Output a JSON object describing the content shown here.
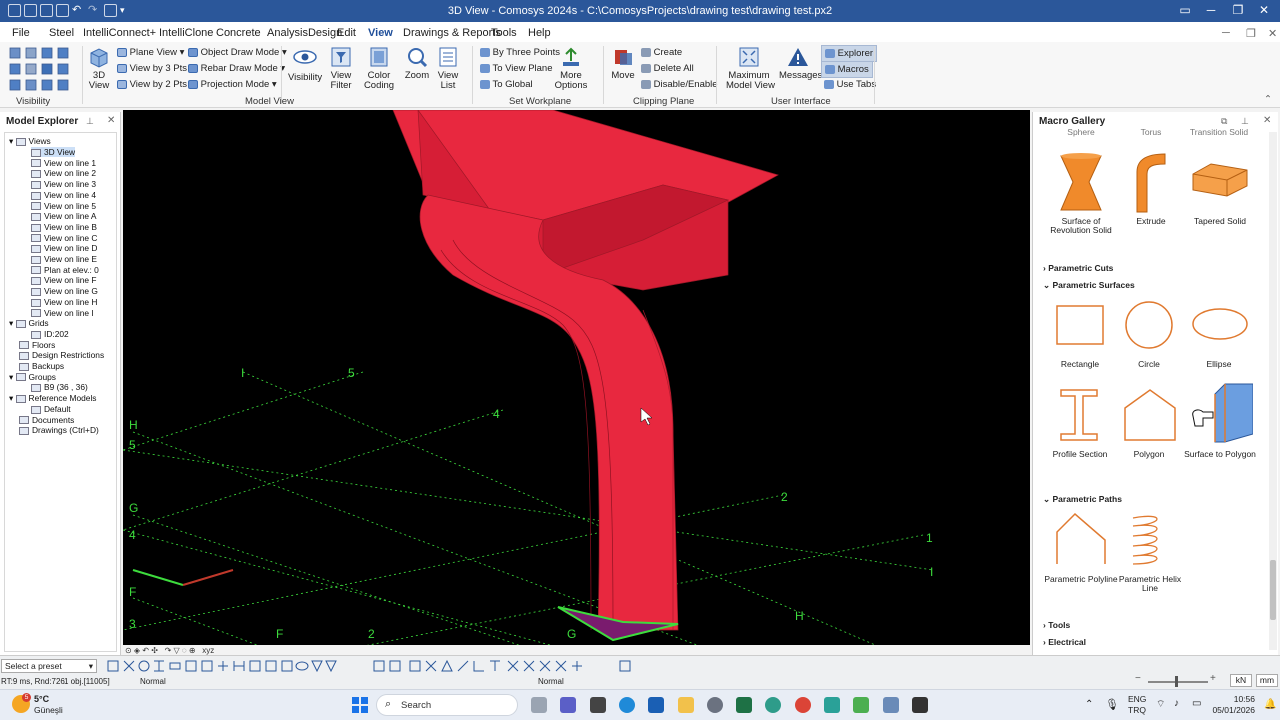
{
  "titlebar": {
    "title": "3D View - Comosys 2024s - C:\\ComosysProjects\\drawing test\\drawing test.px2"
  },
  "menu": [
    "File",
    "Steel",
    "IntelliConnect+",
    "IntelliClone",
    "Concrete",
    "AnalysisDesign",
    "Edit",
    "View",
    "Drawings & Reports",
    "Tools",
    "Help"
  ],
  "menu_active": "View",
  "ribbon": {
    "view3d": "3D\nView",
    "plane_view": "Plane View",
    "view_by_3pts": "View by 3 Pts",
    "view_by_2pts": "View by 2 Pts",
    "object_draw_mode": "Object Draw Mode",
    "rebar_draw_mode": "Rebar Draw Mode",
    "projection_mode": "Projection Mode",
    "visibility": "Visibility",
    "view_filter": "View\nFilter",
    "color_coding": "Color\nCoding",
    "zoom": "Zoom",
    "view_list": "View\nList",
    "by_three_points": "By Three Points",
    "to_view_plane": "To View Plane",
    "to_global": "To Global",
    "more_options": "More\nOptions",
    "move": "Move",
    "create": "Create",
    "delete_all": "Delete All",
    "disable_enable": "Disable/Enable",
    "maximum_model_view": "Maximum\nModel View",
    "messages": "Messages",
    "explorer": "Explorer",
    "macros": "Macros",
    "use_tabs": "Use Tabs",
    "groups": {
      "visibility": "Visibility",
      "model_view": "Model View",
      "set_workplane": "Set Workplane",
      "clipping_plane": "Clipping Plane",
      "user_interface": "User Interface"
    }
  },
  "model_explorer": {
    "title": "Model Explorer",
    "items": [
      "Views",
      "3D View",
      "View on line 1",
      "View on line 2",
      "View on line 3",
      "View on line 4",
      "View on line 5",
      "View on line A",
      "View on line B",
      "View on line C",
      "View on line D",
      "View on line E",
      "Plan at elev.: 0",
      "View on line F",
      "View on line G",
      "View on line H",
      "View on line I",
      "Grids",
      "ID:202",
      "Floors",
      "Design Restrictions",
      "Backups",
      "Groups",
      "B9 (36 , 36)",
      "Reference Models",
      "Default",
      "Documents",
      "Drawings (Ctrl+D)"
    ]
  },
  "viewport": {
    "grid_labels": [
      "I",
      "5",
      "4",
      "H",
      "5",
      "G",
      "4",
      "F",
      "3",
      "F",
      "2",
      "2",
      "1",
      "I",
      "H",
      "G"
    ],
    "body_color": "#e8283f",
    "grid_color": "#3ddc3d"
  },
  "macro_gallery": {
    "title": "Macro Gallery",
    "top_row": [
      "Sphere",
      "Torus",
      "Transition Solid"
    ],
    "solids": [
      "Surface of\nRevolution Solid",
      "Extrude",
      "Tapered Solid"
    ],
    "sections": {
      "cuts": "Parametric Cuts",
      "surfaces": "Parametric Surfaces",
      "paths": "Parametric Paths",
      "tools": "Tools",
      "electrical": "Electrical"
    },
    "surfaces": [
      "Rectangle",
      "Circle",
      "Ellipse",
      "Profile Section",
      "Polygon",
      "Surface to Polygon"
    ],
    "paths": [
      "Parametric Polyline",
      "Parametric Helix Line"
    ],
    "accent": "#e07a30"
  },
  "statusbar": {
    "preset": "Select a preset",
    "viewport_coords": "xyz",
    "rt": "RT:9 ms, Rnd:726",
    "selection": "1 obj.[11005]",
    "mode_left": "Normal",
    "mode_center": "Normal",
    "unit_force": "kN",
    "unit_length": "mm"
  },
  "taskbar": {
    "weather_temp": "5°C",
    "weather_desc": "Güneşli",
    "search": "Search",
    "lang": "ENG",
    "region": "TRQ",
    "time": "10:56",
    "date": "05/01/2026",
    "badge": "5"
  }
}
